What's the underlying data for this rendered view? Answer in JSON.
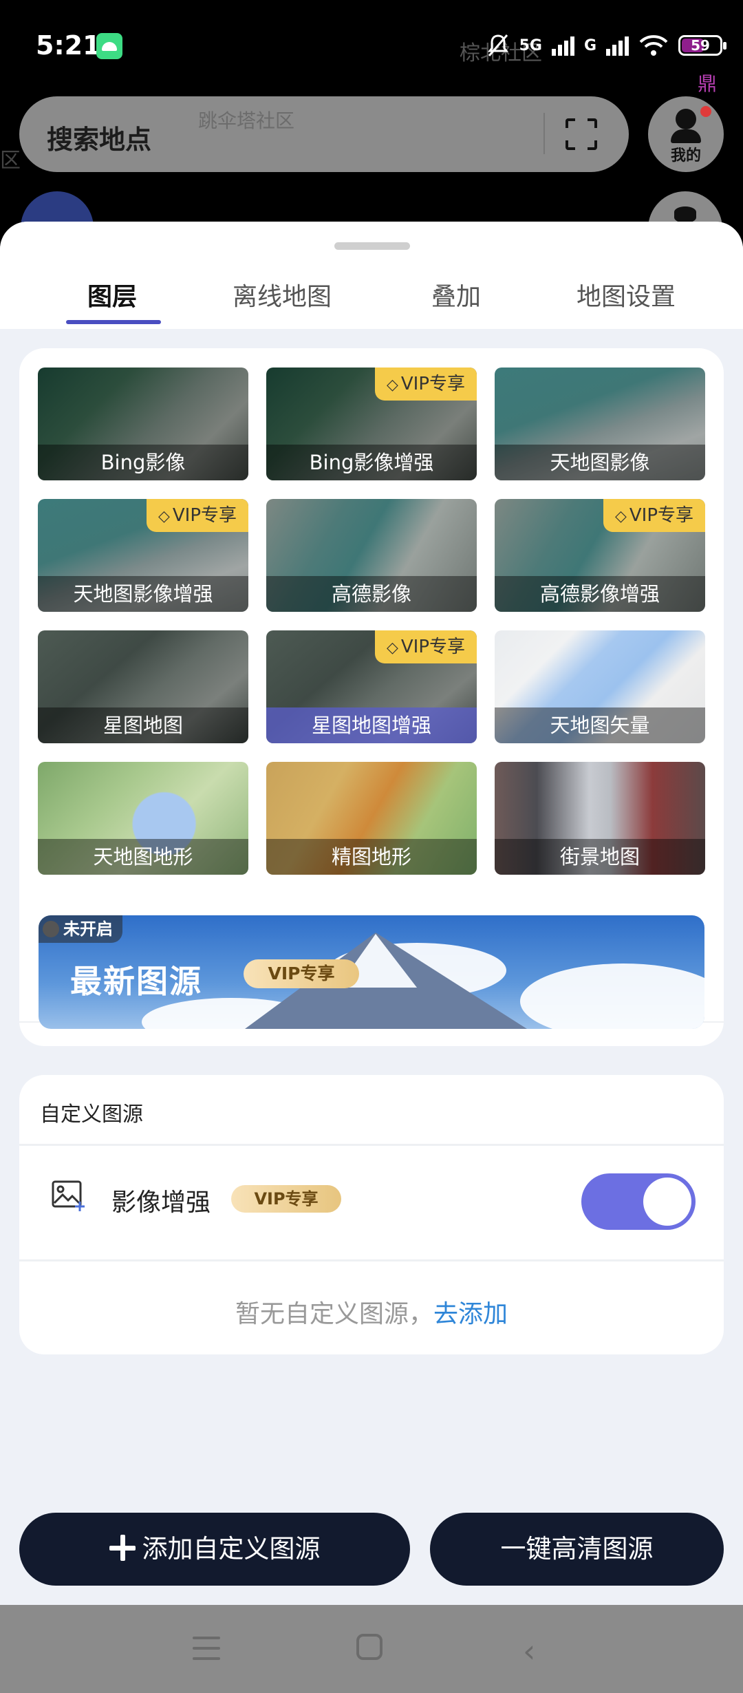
{
  "status_bar": {
    "time": "5:21",
    "background_text": "棕北社区",
    "net_5g": "5G",
    "net_g": "G",
    "battery_level": "59",
    "background_ding": "鼎"
  },
  "map_header": {
    "search_label": "搜索地点",
    "search_background_text": "跳伞塔社区",
    "side_text": "区",
    "me_label": "我的"
  },
  "tabs": [
    {
      "label": "图层"
    },
    {
      "label": "离线地图"
    },
    {
      "label": "叠加"
    },
    {
      "label": "地图设置"
    }
  ],
  "layers": [
    {
      "label": "Bing影像",
      "vip": ""
    },
    {
      "label": "Bing影像增强",
      "vip": "VIP专享"
    },
    {
      "label": "天地图影像",
      "vip": ""
    },
    {
      "label": "天地图影像增强",
      "vip": "VIP专享"
    },
    {
      "label": "高德影像",
      "vip": ""
    },
    {
      "label": "高德影像增强",
      "vip": "VIP专享"
    },
    {
      "label": "星图地图",
      "vip": ""
    },
    {
      "label": "星图地图增强",
      "vip": "VIP专享"
    },
    {
      "label": "天地图矢量",
      "vip": ""
    },
    {
      "label": "天地图地形",
      "vip": ""
    },
    {
      "label": "精图地形",
      "vip": ""
    },
    {
      "label": "街景地图",
      "vip": ""
    }
  ],
  "banner": {
    "status_tag": "未开启",
    "title": "最新图源",
    "vip_label": "VIP专享"
  },
  "custom_sources": {
    "section_title": "自定义图源",
    "enhancement_label": "影像增强",
    "enhancement_vip": "VIP专享",
    "enhancement_enabled": true,
    "empty_text": "暂无自定义图源，",
    "add_link": "去添加"
  },
  "actions": {
    "add_custom_label": "添加自定义图源",
    "one_click_hd_label": "一键高清图源"
  },
  "colors": {
    "accent": "#6c6fe2",
    "tab_indicator": "#4a4ec1",
    "vip_gold": "#f5cb4a",
    "dark_button": "#121a2e",
    "link": "#2f86d8"
  }
}
